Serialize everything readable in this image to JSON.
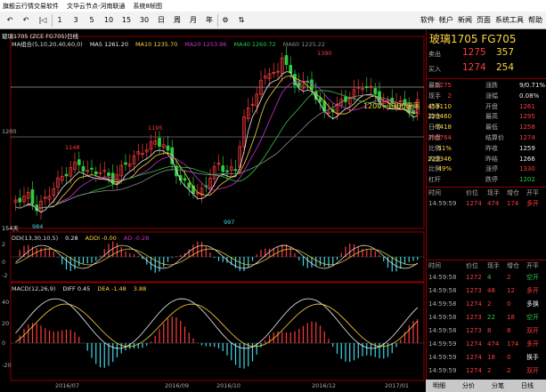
{
  "titlebar": {
    "items": [
      "旗舰云行情交易软件",
      "文华云节点-河南联通",
      "系统8帧图"
    ]
  },
  "toolbar": {
    "left": [
      "↶",
      "↶",
      "|◁",
      "1",
      "3",
      "5",
      "10",
      "15",
      "30",
      "日",
      "周",
      "月",
      "年",
      "⚙",
      "⇅"
    ],
    "right": [
      "帐户",
      "新闻",
      "页面",
      "系统工具",
      "帮助"
    ],
    "first": "软件"
  },
  "main": {
    "header": "玻璃1705 (ZCE FG705)日线",
    "ma": [
      "MA组合(5,10,20,40,60,0)",
      "MA5 1261.20",
      "MA10 1235.70",
      "MA20 1253.96",
      "MA40 1260.72",
      "MA60 1225.22"
    ],
    "price_labels": [
      "1390",
      "1195",
      "1148",
      "997",
      "984",
      "1200~1300震荡",
      "1200",
      "154天"
    ],
    "ddi": [
      "DDI(13,30,10,5)",
      "0.28",
      "ADDI -0.00",
      "AD -0.28"
    ],
    "macd": [
      "MACD(12,26,9)",
      "DIFF 0.45",
      "DEA -1.48",
      "3.88"
    ],
    "ddi_ticks": [
      "2",
      "0",
      "-2"
    ],
    "macd_ticks": [
      "40",
      "20",
      "0",
      "-20"
    ],
    "dates": [
      "2016/07",
      "2016/09",
      "2016/10",
      "2016/12",
      "2017/01"
    ]
  },
  "colors": {
    "up": "#ff3b3b",
    "down": "#2ecc40",
    "ma5": "#eeeeee",
    "ma10": "#ffd23f",
    "ma20": "#cc33cc",
    "ma40": "#2ecc40",
    "ma60": "#8a8a8a",
    "accent": "#8b0000"
  },
  "quote": {
    "symbol": "玻璃1705 FG705",
    "sell": {
      "label": "卖出",
      "price": "1275",
      "vol": "357"
    },
    "buy": {
      "label": "买入",
      "price": "1274",
      "vol": "254"
    },
    "rows": [
      [
        "最新",
        "1275",
        "涨跌",
        "9/0.71%"
      ],
      [
        "现手",
        "2",
        "涨幅",
        "0.08%"
      ],
      [
        "总手",
        "459110",
        "开盘",
        "1261"
      ],
      [
        "持仓",
        "223460",
        "最高",
        "1295"
      ],
      [
        "日增",
        "-7418",
        "最低",
        "1258"
      ],
      [
        "外盘",
        "235764",
        "结算价",
        "1274"
      ],
      [
        "比例",
        "51%",
        "昨收",
        "1259"
      ],
      [
        "内盘",
        "223346",
        "昨结",
        "1266"
      ],
      [
        "比例",
        "49%",
        "涨停",
        "1330"
      ],
      [
        "杠杆",
        "",
        "跌停",
        "1202"
      ]
    ]
  },
  "ticks_head": [
    "时间",
    "价位",
    "现手",
    "增仓",
    "开平"
  ],
  "ticks_top": [
    [
      "14:59:59",
      "1274",
      "474",
      "174",
      "多开"
    ]
  ],
  "ticks": [
    [
      "14:59:58",
      "1272",
      "4",
      "2",
      "空开"
    ],
    [
      "14:59:58",
      "1273",
      "48",
      "12",
      "多开"
    ],
    [
      "14:59:58",
      "1274",
      "2",
      "0",
      "多换"
    ],
    [
      "14:59:58",
      "1273",
      "22",
      "18",
      "空开"
    ],
    [
      "14:59:58",
      "1273",
      "8",
      "8",
      "双开"
    ],
    [
      "14:59:59",
      "1274",
      "474",
      "174",
      "多开"
    ],
    [
      "14:59:59",
      "1274",
      "18",
      "0",
      "换手"
    ],
    [
      "14:59:59",
      "1274",
      "2",
      "2",
      "双开"
    ],
    [
      "14:59:59",
      "1274",
      "2",
      "0",
      "多换"
    ]
  ],
  "bottom_tabs": [
    "明细",
    "分价",
    "分笔",
    "日线"
  ]
}
